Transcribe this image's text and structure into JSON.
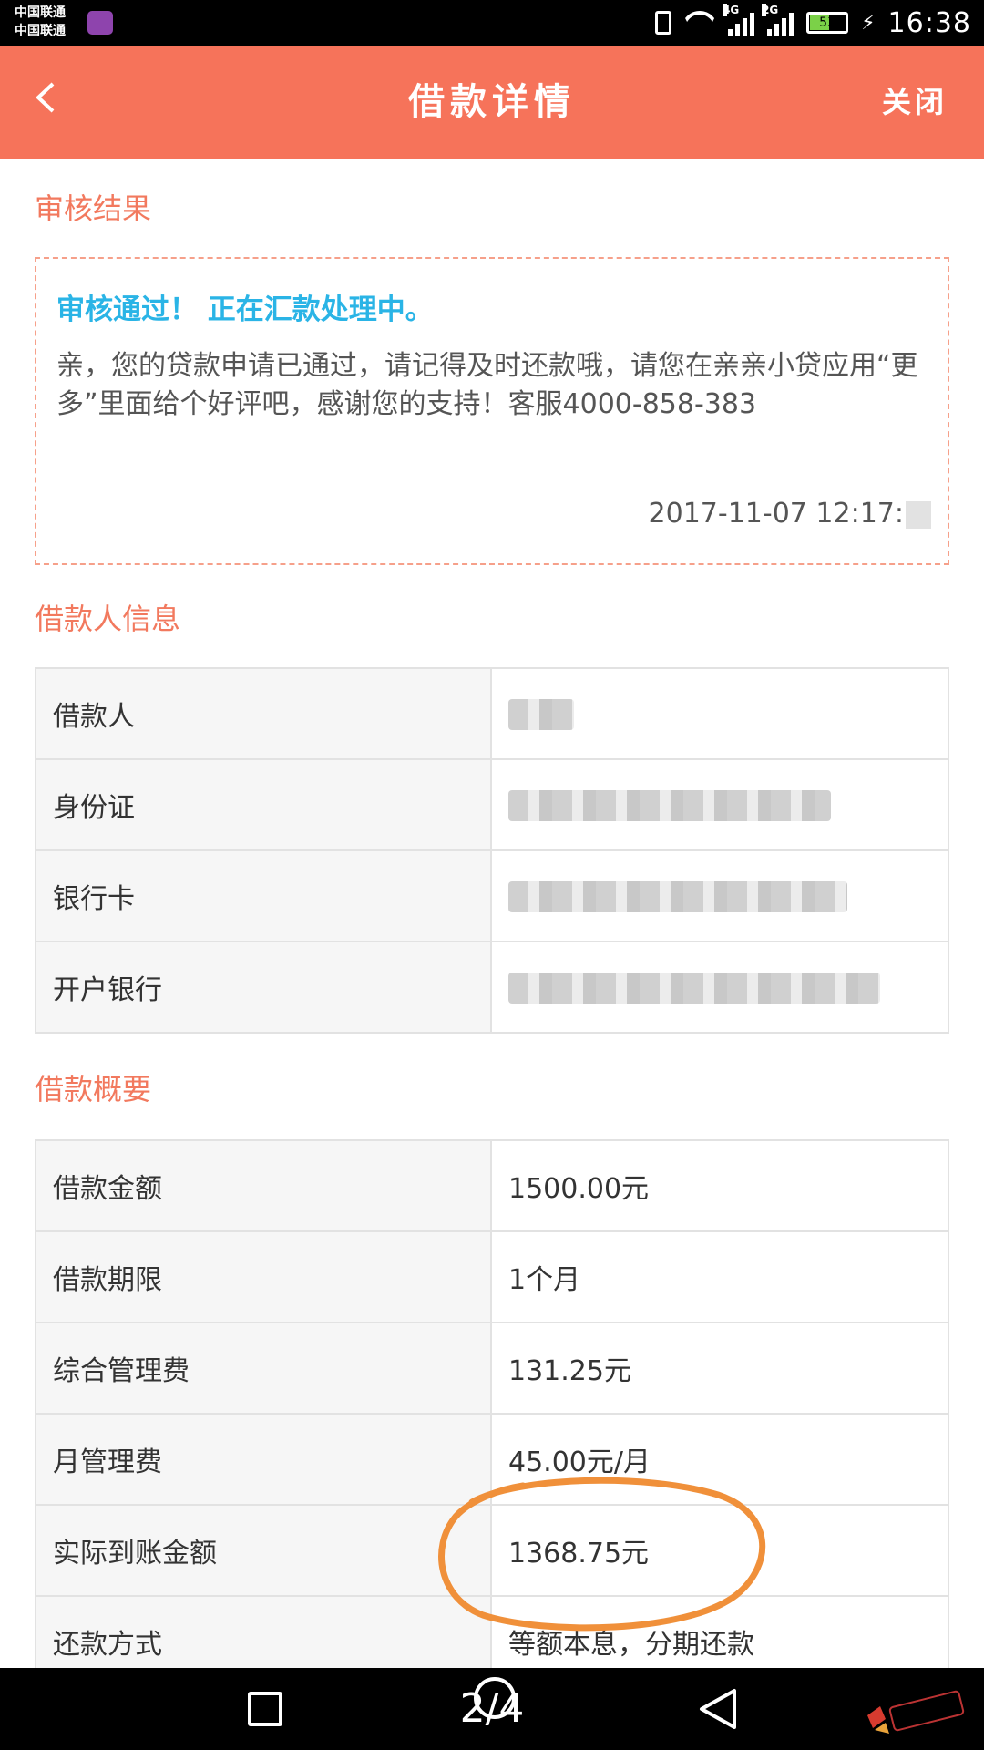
{
  "status_bar": {
    "carrier_1": "中国联通",
    "carrier_2": "中国联通",
    "net_1": "4G",
    "net_2": "2G",
    "battery": "53",
    "time": "16:38"
  },
  "header": {
    "title": "借款详情",
    "close_label": "关闭",
    "back_icon": "chevron-left-icon"
  },
  "review": {
    "section_title": "审核结果",
    "status": "审核通过！ 正在汇款处理中。",
    "message": "亲，您的贷款申请已通过，请记得及时还款哦，请您在亲亲小贷应用“更多”里面给个好评吧，感谢您的支持！客服4000-858-383",
    "time": "2017-11-07 12:17:"
  },
  "borrower": {
    "section_title": "借款人信息",
    "rows": [
      {
        "label": "借款人"
      },
      {
        "label": "身份证"
      },
      {
        "label": "银行卡"
      },
      {
        "label": "开户银行"
      }
    ]
  },
  "summary": {
    "section_title": "借款概要",
    "rows": [
      {
        "label": "借款金额",
        "value": "1500.00元"
      },
      {
        "label": "借款期限",
        "value": "1个月"
      },
      {
        "label": "综合管理费",
        "value": "131.25元"
      },
      {
        "label": "月管理费",
        "value": "45.00元/月"
      },
      {
        "label": "实际到账金额",
        "value": "1368.75元"
      },
      {
        "label": "还款方式",
        "value": "等额本息，分期还款"
      }
    ]
  },
  "nav": {
    "pager": "2/4"
  },
  "colors": {
    "header_bg": "#f6735a",
    "section_title": "#f2795e",
    "status_text": "#2ab4e6",
    "annotation": "#f0903a"
  }
}
